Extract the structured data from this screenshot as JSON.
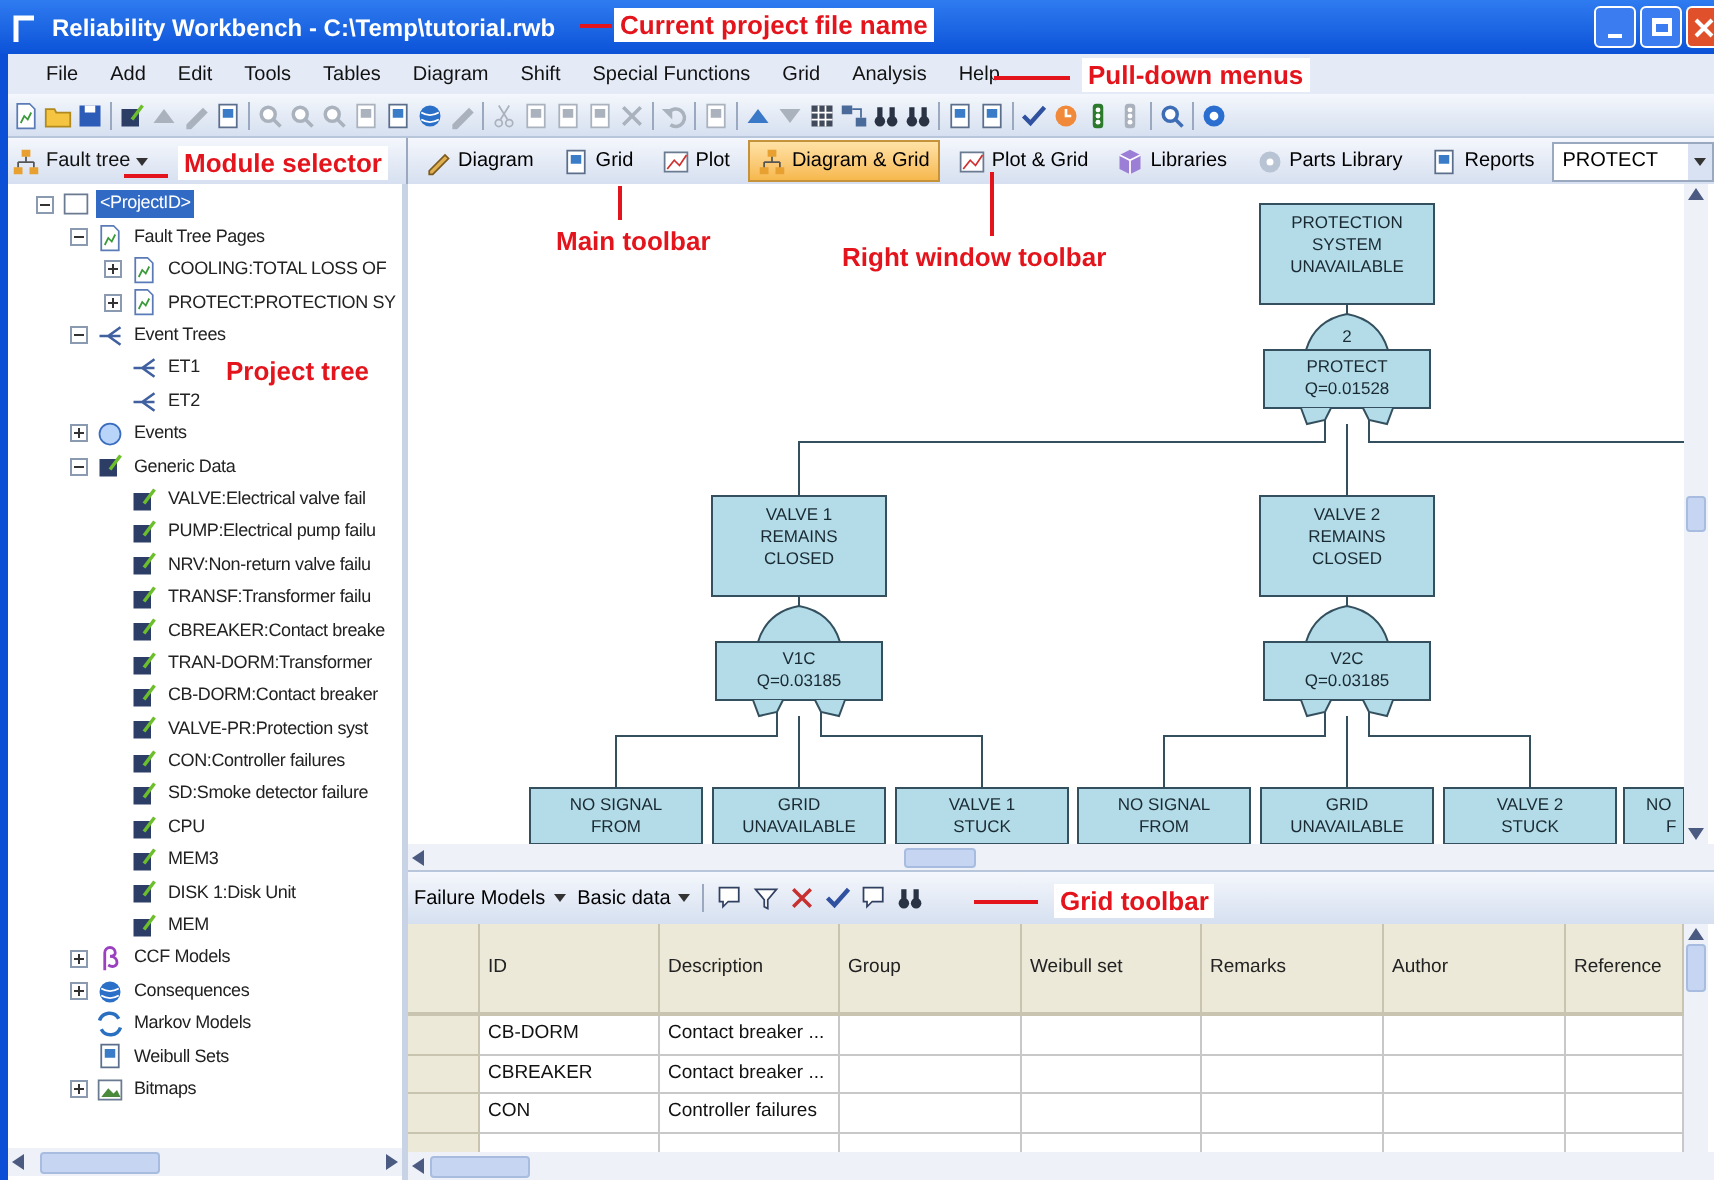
{
  "window": {
    "title": "Reliability Workbench - C:\\Temp\\tutorial.rwb"
  },
  "menu": [
    "File",
    "Add",
    "Edit",
    "Tools",
    "Tables",
    "Diagram",
    "Shift",
    "Special Functions",
    "Grid",
    "Analysis",
    "Help"
  ],
  "main_toolbar": {
    "groups": [
      [
        {
          "kind": "page",
          "disabled": false
        },
        {
          "kind": "folder",
          "disabled": false
        },
        {
          "kind": "disk",
          "disabled": false
        }
      ],
      [
        {
          "kind": "notebook",
          "disabled": false
        },
        {
          "kind": "up",
          "disabled": true
        },
        {
          "kind": "pencil",
          "disabled": true
        },
        {
          "kind": "doc",
          "disabled": false
        }
      ],
      [
        {
          "kind": "magnifier",
          "disabled": true
        },
        {
          "kind": "magnifier",
          "disabled": true
        },
        {
          "kind": "magnifier",
          "disabled": true
        },
        {
          "kind": "doc",
          "disabled": true
        },
        {
          "kind": "doc",
          "disabled": false
        },
        {
          "kind": "globe",
          "disabled": false
        },
        {
          "kind": "pencil",
          "disabled": true
        }
      ],
      [
        {
          "kind": "scissors",
          "disabled": true
        },
        {
          "kind": "doc",
          "disabled": true
        },
        {
          "kind": "doc",
          "disabled": true
        },
        {
          "kind": "doc",
          "disabled": true
        },
        {
          "kind": "cross",
          "disabled": true
        }
      ],
      [
        {
          "kind": "undo",
          "disabled": true
        }
      ],
      [
        {
          "kind": "doc",
          "disabled": true
        }
      ],
      [
        {
          "kind": "up",
          "disabled": false
        },
        {
          "kind": "down",
          "disabled": true
        },
        {
          "kind": "grid",
          "disabled": false
        },
        {
          "kind": "link",
          "disabled": false
        },
        {
          "kind": "binoculars",
          "disabled": false
        },
        {
          "kind": "binoculars",
          "disabled": false
        }
      ],
      [
        {
          "kind": "doc",
          "disabled": false
        },
        {
          "kind": "doc",
          "disabled": false
        }
      ],
      [
        {
          "kind": "check",
          "disabled": false
        },
        {
          "kind": "clock",
          "disabled": false
        },
        {
          "kind": "traffic",
          "disabled": false
        },
        {
          "kind": "traffic",
          "disabled": true
        }
      ],
      [
        {
          "kind": "zoom",
          "disabled": false
        }
      ],
      [
        {
          "kind": "help",
          "disabled": false
        }
      ]
    ]
  },
  "module_selector": {
    "value": "Fault tree"
  },
  "window_toolbar": {
    "tabs": [
      {
        "label": "Diagram",
        "kind": "pencil",
        "selected": false
      },
      {
        "label": "Grid",
        "kind": "doc",
        "selected": false
      },
      {
        "label": "Plot",
        "kind": "chart",
        "selected": false
      },
      {
        "label": "Diagram & Grid",
        "kind": "tree",
        "selected": true
      },
      {
        "label": "Plot & Grid",
        "kind": "chart",
        "selected": false
      },
      {
        "label": "Libraries",
        "kind": "cube",
        "selected": false
      },
      {
        "label": "Parts Library",
        "kind": "disc",
        "selected": false
      },
      {
        "label": "Reports",
        "kind": "doc",
        "selected": false
      }
    ],
    "combo": {
      "value": "PROTECT"
    }
  },
  "project_tree": {
    "items": [
      {
        "label": "<ProjectID>",
        "kind": "square",
        "selected": true,
        "expanded": true,
        "children": [
          {
            "label": "Fault Tree Pages",
            "kind": "page",
            "selected": false,
            "expanded": true,
            "children": [
              {
                "label": "COOLING:TOTAL LOSS OF",
                "kind": "page",
                "selected": false,
                "expanded": false
              },
              {
                "label": "PROTECT:PROTECTION SY",
                "kind": "page",
                "selected": false,
                "expanded": false
              }
            ]
          },
          {
            "label": "Event Trees",
            "kind": "branch",
            "selected": false,
            "expanded": true,
            "children": [
              {
                "label": "ET1",
                "kind": "branch",
                "selected": false
              },
              {
                "label": "ET2",
                "kind": "branch",
                "selected": false
              }
            ]
          },
          {
            "label": "Events",
            "kind": "circle",
            "selected": false,
            "expanded": false
          },
          {
            "label": "Generic Data",
            "kind": "notebook",
            "selected": false,
            "expanded": true,
            "children": [
              {
                "label": "VALVE:Electrical valve fail",
                "kind": "notebook",
                "selected": false
              },
              {
                "label": "PUMP:Electrical pump failu",
                "kind": "notebook",
                "selected": false
              },
              {
                "label": "NRV:Non-return valve failu",
                "kind": "notebook",
                "selected": false
              },
              {
                "label": "TRANSF:Transformer failu",
                "kind": "notebook",
                "selected": false
              },
              {
                "label": "CBREAKER:Contact breake",
                "kind": "notebook",
                "selected": false
              },
              {
                "label": "TRAN-DORM:Transformer",
                "kind": "notebook",
                "selected": false
              },
              {
                "label": "CB-DORM:Contact breaker",
                "kind": "notebook",
                "selected": false
              },
              {
                "label": "VALVE-PR:Protection syst",
                "kind": "notebook",
                "selected": false
              },
              {
                "label": "CON:Controller failures",
                "kind": "notebook",
                "selected": false
              },
              {
                "label": "SD:Smoke detector failure",
                "kind": "notebook",
                "selected": false
              },
              {
                "label": "CPU",
                "kind": "notebook",
                "selected": false
              },
              {
                "label": "MEM3",
                "kind": "notebook",
                "selected": false
              },
              {
                "label": "DISK 1:Disk Unit",
                "kind": "notebook",
                "selected": false
              },
              {
                "label": "MEM",
                "kind": "notebook",
                "selected": false
              }
            ]
          },
          {
            "label": "CCF Models",
            "kind": "beta",
            "selected": false,
            "expanded": false
          },
          {
            "label": "Consequences",
            "kind": "globe",
            "selected": false,
            "expanded": false
          },
          {
            "label": "Markov Models",
            "kind": "arrows",
            "selected": false
          },
          {
            "label": "Weibull Sets",
            "kind": "doc",
            "selected": false
          },
          {
            "label": "Bitmaps",
            "kind": "image",
            "selected": false,
            "expanded": false
          }
        ]
      }
    ]
  },
  "diagram": {
    "top_event": {
      "lines": [
        "PROTECTION",
        "SYSTEM",
        "UNAVAILABLE"
      ],
      "gate": {
        "kind": "vote",
        "vote": "2",
        "name": "PROTECT",
        "q": "Q=0.01528"
      },
      "children": [
        {
          "lines": [
            "VALVE 1",
            "REMAINS",
            "CLOSED"
          ],
          "gate": {
            "kind": "or",
            "name": "V1C",
            "q": "Q=0.03185"
          },
          "children": [
            {
              "lines": [
                "NO SIGNAL",
                "FROM"
              ]
            },
            {
              "lines": [
                "GRID",
                "UNAVAILABLE"
              ]
            },
            {
              "lines": [
                "VALVE 1",
                "STUCK"
              ]
            }
          ]
        },
        {
          "lines": [
            "VALVE 2",
            "REMAINS",
            "CLOSED"
          ],
          "gate": {
            "kind": "or",
            "name": "V2C",
            "q": "Q=0.03185"
          },
          "children": [
            {
              "lines": [
                "NO SIGNAL",
                "FROM"
              ]
            },
            {
              "lines": [
                "GRID",
                "UNAVAILABLE"
              ]
            },
            {
              "lines": [
                "VALVE 2",
                "STUCK"
              ]
            }
          ]
        }
      ]
    },
    "partial_events": [
      {
        "lines": [
          "NO",
          "F"
        ]
      }
    ]
  },
  "grid_toolbar": {
    "dropdowns": [
      "Failure Models",
      "Basic data"
    ],
    "buttons": [
      {
        "kind": "comment"
      },
      {
        "kind": "filter"
      },
      {
        "kind": "cross"
      },
      {
        "kind": "check"
      },
      {
        "kind": "comment"
      },
      {
        "kind": "binoculars"
      }
    ]
  },
  "grid": {
    "columns": [
      "ID",
      "Description",
      "Group",
      "Weibull set",
      "Remarks",
      "Author",
      "Reference"
    ],
    "rows": [
      {
        "cells": [
          "CB-DORM",
          "Contact breaker ..."
        ]
      },
      {
        "cells": [
          "CBREAKER",
          "Contact breaker ..."
        ]
      },
      {
        "cells": [
          "CON",
          "Controller failures"
        ]
      }
    ]
  },
  "annotations": [
    {
      "text": "Current project file name",
      "leader_line": true
    },
    {
      "text": "Pull-down menus",
      "leader_line": true
    },
    {
      "text": "Module selector",
      "leader_line": true
    },
    {
      "text": "Main toolbar",
      "leader_line": true
    },
    {
      "text": "Right window toolbar",
      "leader_line": true
    },
    {
      "text": "Project tree",
      "leader_line": false
    },
    {
      "text": "Grid toolbar",
      "leader_line": true
    }
  ]
}
